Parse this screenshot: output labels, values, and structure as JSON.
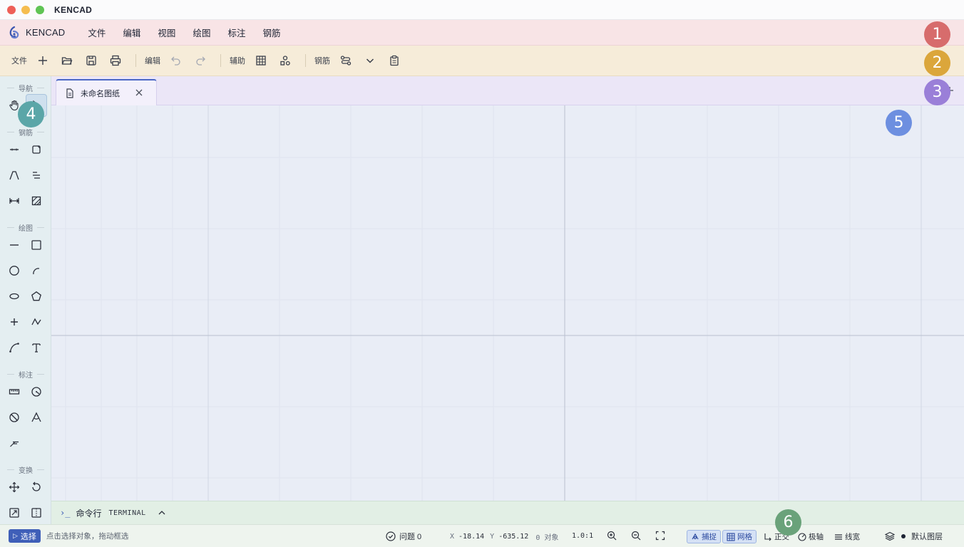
{
  "window": {
    "title": "KENCAD"
  },
  "menubar": {
    "brand": "KENCAD",
    "items": [
      "文件",
      "编辑",
      "视图",
      "绘图",
      "标注",
      "钢筋"
    ]
  },
  "toolbar": {
    "file_label": "文件",
    "edit_label": "编辑",
    "aux_label": "辅助",
    "rebar_label": "钢筋"
  },
  "tabs": {
    "active": "未命名图纸"
  },
  "sidebar": {
    "sections": {
      "nav": "导航",
      "rebar": "钢筋",
      "draw": "绘图",
      "dimension": "标注",
      "transform": "变换"
    }
  },
  "terminal": {
    "prompt": "›_",
    "label": "命令行",
    "sublabel": "TERMINAL"
  },
  "statusbar": {
    "mode": "选择",
    "hint": "点击选择对象，拖动框选",
    "problems": "问题 0",
    "x_label": "X",
    "x_value": "-18.14",
    "y_label": "Y",
    "y_value": "-635.12",
    "objects": "0 对象",
    "scale": "1.0:1",
    "snap": "捕捉",
    "grid": "网格",
    "ortho": "正交",
    "polar": "极轴",
    "lineweight": "线宽",
    "layer": "默认图层"
  },
  "markers": [
    "1",
    "2",
    "3",
    "4",
    "5",
    "6"
  ],
  "colors": {
    "menubar_bg": "#f8e4e6",
    "toolbar_bg": "#f6ecd9",
    "tabbar_bg": "#ebe6f7",
    "sidebar_bg": "#e4eef1",
    "canvas_bg": "#e9edf6",
    "terminal_bg": "#e2efe5",
    "accent": "#3f5fb8",
    "marker_1": "#d76c6c",
    "marker_2": "#dba63b",
    "marker_3": "#9a7fd8",
    "marker_4": "#5ba6a8",
    "marker_5": "#6d8fe0",
    "marker_6": "#6aa27a"
  }
}
